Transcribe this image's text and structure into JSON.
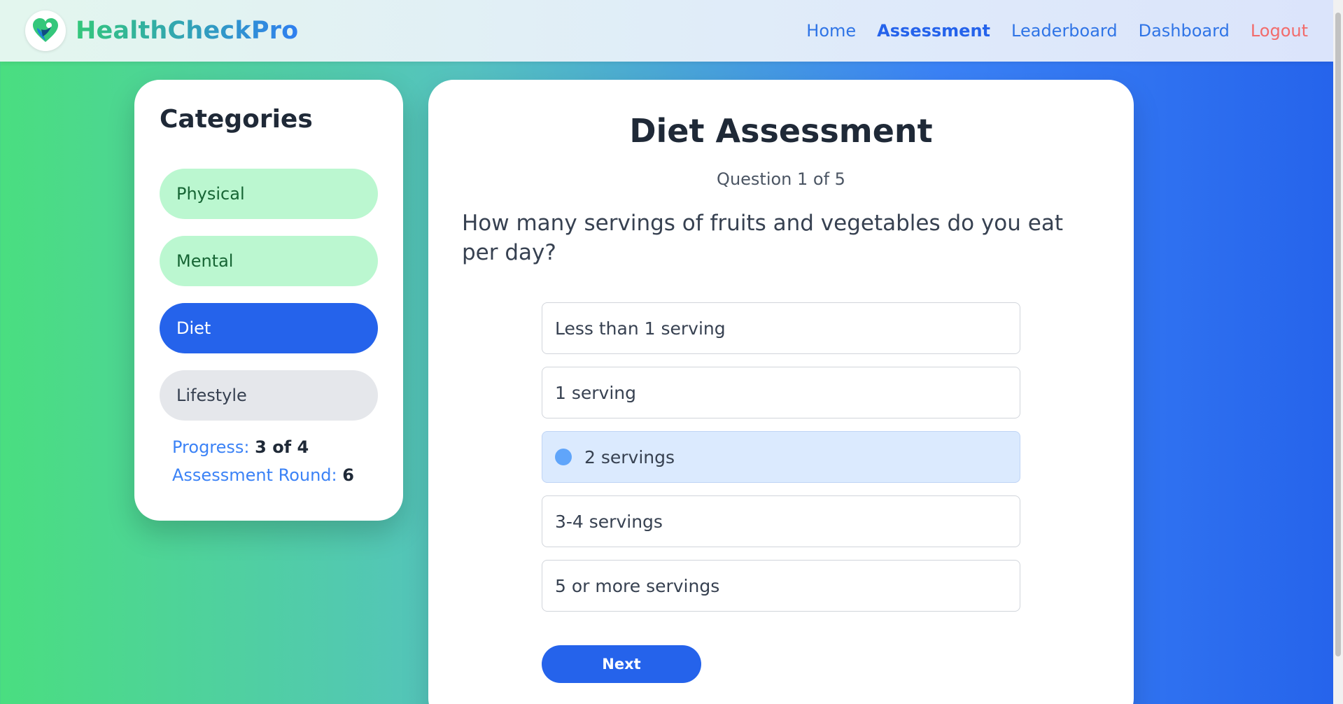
{
  "brand": {
    "name": "HealthCheckPro",
    "logo": "heart-leaf-icon"
  },
  "nav": {
    "items": [
      {
        "label": "Home"
      },
      {
        "label": "Assessment"
      },
      {
        "label": "Leaderboard"
      },
      {
        "label": "Dashboard"
      },
      {
        "label": "Logout"
      }
    ],
    "active": "Assessment"
  },
  "sidebar": {
    "title": "Categories",
    "items": [
      {
        "label": "Physical",
        "state": "completed"
      },
      {
        "label": "Mental",
        "state": "completed"
      },
      {
        "label": "Diet",
        "state": "active"
      },
      {
        "label": "Lifestyle",
        "state": "pending"
      }
    ],
    "progress_label": "Progress:",
    "progress_value": "3 of 4",
    "round_label": "Assessment Round:",
    "round_value": "6"
  },
  "assessment": {
    "title": "Diet Assessment",
    "question_counter": "Question 1 of 5",
    "question": "How many servings of fruits and vegetables do you eat per day?",
    "options": [
      {
        "label": "Less than 1 serving"
      },
      {
        "label": "1 serving"
      },
      {
        "label": "2 servings"
      },
      {
        "label": "3-4 servings"
      },
      {
        "label": "5 or more servings"
      }
    ],
    "selected_option": "2 servings",
    "next_label": "Next"
  },
  "colors": {
    "primary": "#2563eb",
    "completed_bg": "#bbf7d0",
    "pending_bg": "#e5e7eb",
    "selected_bg": "#dbeafe",
    "logout": "#f26b6b"
  }
}
